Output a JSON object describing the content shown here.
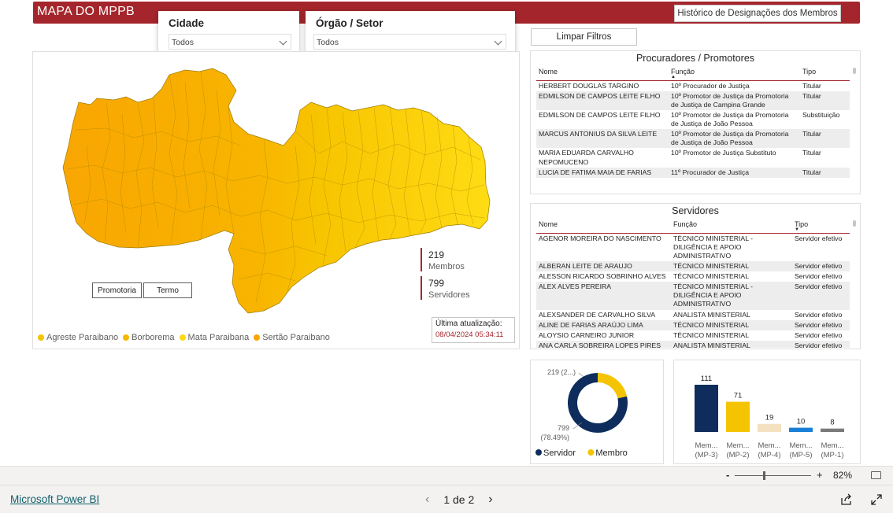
{
  "header": {
    "title": "MAPA DO MPPB",
    "history_button": "Histórico de Designações dos Membros"
  },
  "filters": {
    "cidade": {
      "title": "Cidade",
      "value": "Todos"
    },
    "orgao": {
      "title": "Órgão / Setor",
      "value": "Todos"
    },
    "clear_button": "Limpar Filtros"
  },
  "map": {
    "kpis": [
      {
        "value": "219",
        "label": "Membros"
      },
      {
        "value": "799",
        "label": "Servidores"
      }
    ],
    "buttons": {
      "promotoria": "Promotoria",
      "termo": "Termo"
    },
    "update": {
      "label": "Última atualização:",
      "value": "08/04/2024 05:34:11"
    },
    "legend": [
      {
        "label": "Agreste Paraibano",
        "color": "#f5c400"
      },
      {
        "label": "Borborema",
        "color": "#f6b800"
      },
      {
        "label": "Mata Paraibana",
        "color": "#ffd814"
      },
      {
        "label": "Sertão Paraibano",
        "color": "#f9a602"
      }
    ]
  },
  "procuradores": {
    "title": "Procuradores / Promotores",
    "columns": [
      "Nome",
      "Função",
      "Tipo"
    ],
    "rows": [
      {
        "nome": "HERBERT DOUGLAS TARGINO",
        "funcao": "10º Procurador de Justiça",
        "tipo": "Titular"
      },
      {
        "nome": "EDMILSON DE CAMPOS LEITE FILHO",
        "funcao": "10º Promotor de Justiça da Promotoria de Justiça de Campina Grande",
        "tipo": "Titular"
      },
      {
        "nome": "EDMILSON DE CAMPOS LEITE FILHO",
        "funcao": "10º Promotor de Justiça da Promotoria de Justiça de João Pessoa",
        "tipo": "Substituição"
      },
      {
        "nome": "MARCUS ANTONIUS DA SILVA LEITE",
        "funcao": "10º Promotor de Justiça da Promotoria de Justiça de João Pessoa",
        "tipo": "Titular"
      },
      {
        "nome": "MARIA EDUARDA CARVALHO NEPOMUCENO",
        "funcao": "10º Promotor de Justiça Substituto",
        "tipo": "Titular"
      },
      {
        "nome": "LUCIA DE FATIMA MAIA DE FARIAS",
        "funcao": "11º Procurador de Justiça",
        "tipo": "Titular"
      }
    ]
  },
  "servidores": {
    "title": "Servidores",
    "columns": [
      "Nome",
      "Função",
      "Tipo"
    ],
    "rows": [
      {
        "nome": "AGENOR MOREIRA DO NASCIMENTO",
        "funcao": "TÉCNICO MINISTERIAL - DILIGÊNCIA E APOIO ADMINISTRATIVO",
        "tipo": "Servidor efetivo"
      },
      {
        "nome": "ALBERAN LEITE DE ARAUJO",
        "funcao": "TÉCNICO MINISTERIAL",
        "tipo": "Servidor efetivo"
      },
      {
        "nome": "ALESSON RICARDO SOBRINHO ALVES",
        "funcao": "TÉCNICO MINISTERIAL",
        "tipo": "Servidor efetivo"
      },
      {
        "nome": "ALEX ALVES PEREIRA",
        "funcao": "TÉCNICO MINISTERIAL - DILIGÊNCIA E APOIO ADMINISTRATIVO",
        "tipo": "Servidor efetivo"
      },
      {
        "nome": "ALEXSANDER DE CARVALHO SILVA",
        "funcao": "ANALISTA MINISTERIAL",
        "tipo": "Servidor efetivo"
      },
      {
        "nome": "ALINE DE FARIAS ARAÚJO LIMA",
        "funcao": "TÉCNICO MINISTERIAL",
        "tipo": "Servidor efetivo"
      },
      {
        "nome": "ALOYSIO CARNEIRO JUNIOR",
        "funcao": "TÉCNICO MINISTERIAL",
        "tipo": "Servidor efetivo"
      },
      {
        "nome": "ANA CARLA SOBREIRA LOPES PIRES DE",
        "funcao": "ANALISTA MINISTERIAL",
        "tipo": "Servidor efetivo"
      }
    ]
  },
  "chart_data": [
    {
      "type": "pie",
      "labels": [
        "Servidor",
        "Membro"
      ],
      "values": [
        799,
        219
      ],
      "data_labels": [
        "799 (78.49%)",
        "219 (2...)"
      ],
      "colors": [
        "#0e2d5c",
        "#f5c400"
      ],
      "legend_position": "bottom"
    },
    {
      "type": "bar",
      "categories": [
        "Mem... (MP-3)",
        "Mem... (MP-2)",
        "Mem... (MP-4)",
        "Mem... (MP-5)",
        "Mem... (MP-1)"
      ],
      "values": [
        111,
        71,
        19,
        10,
        8
      ],
      "colors": [
        "#0e2d5c",
        "#f5c400",
        "#f4e1c0",
        "#1a7fd6",
        "#7a7a7a"
      ]
    }
  ],
  "zoom": {
    "level": "82%",
    "minus": "-",
    "plus": "+"
  },
  "footer": {
    "brand": "Microsoft Power BI",
    "page": "1 de 2"
  }
}
